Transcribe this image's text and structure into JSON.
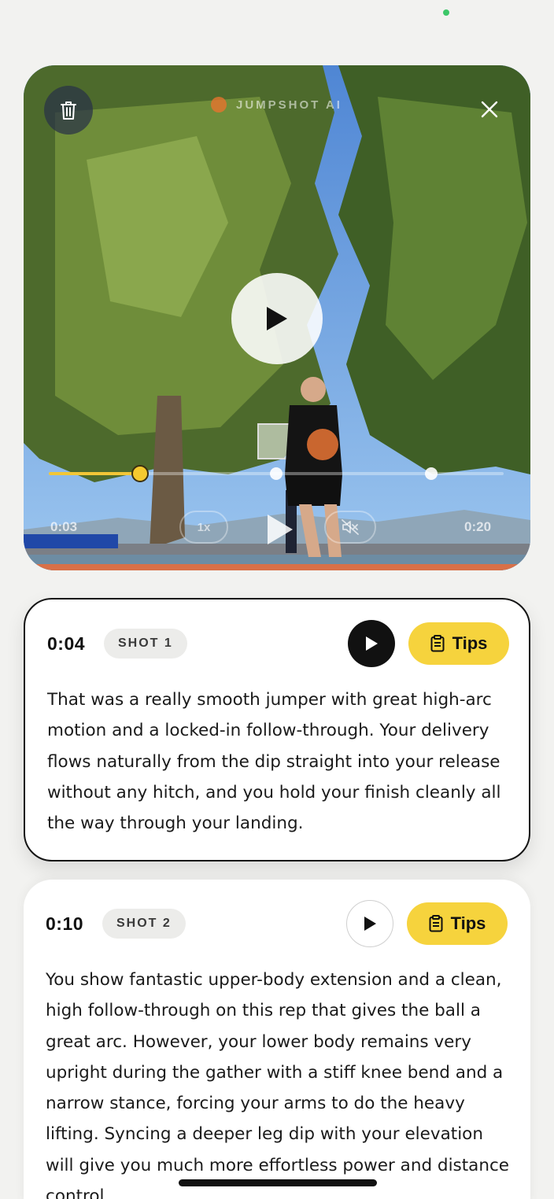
{
  "video": {
    "brand": "JUMPSHOT AI",
    "current_time": "0:03",
    "duration": "0:20",
    "speed": "1x",
    "progress": 0.2,
    "shot_markers": [
      0.2,
      0.5,
      0.84
    ]
  },
  "shots": [
    {
      "time": "0:04",
      "label": "SHOT 1",
      "tips_label": "Tips",
      "feedback": "That was a really smooth jumper with great high-arc motion and a locked-in follow-through. Your delivery flows naturally from the dip straight into your release without any hitch, and you hold your finish cleanly all the way through your landing."
    },
    {
      "time": "0:10",
      "label": "SHOT 2",
      "tips_label": "Tips",
      "feedback": "You show fantastic upper-body extension and a clean, high follow-through on this rep that gives the ball a great arc. However, your lower body remains very upright during the gather with a stiff knee bend and a narrow stance, forcing your arms to do the heavy lifting. Syncing a deeper leg dip with your elevation will give you much more effortless power and distance control."
    }
  ],
  "icons": {
    "delete": "trash-icon",
    "close": "close-icon",
    "play": "play-icon",
    "mute": "speaker-muted-icon",
    "tips": "clipboard-icon"
  },
  "colors": {
    "accent": "#f6d33d",
    "background": "#f2f2f0",
    "ink": "#111111"
  }
}
